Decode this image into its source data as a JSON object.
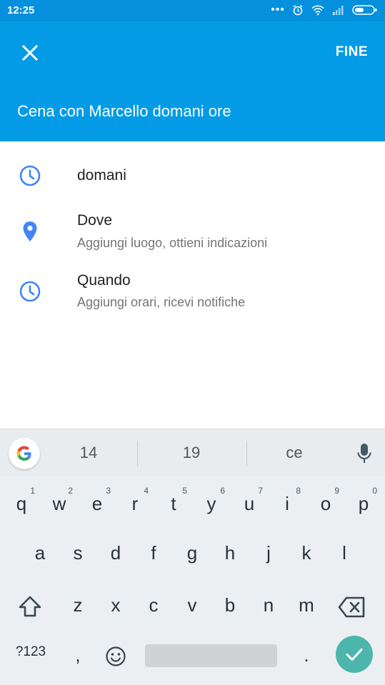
{
  "status_bar": {
    "time": "12:25"
  },
  "header": {
    "done_label": "FINE",
    "title_value": "Cena con Marcello domani ore"
  },
  "rows": [
    {
      "icon": "clock-icon",
      "title": "domani",
      "subtitle": ""
    },
    {
      "icon": "location-pin-icon",
      "title": "Dove",
      "subtitle": "Aggiungi luogo, ottieni indicazioni"
    },
    {
      "icon": "clock-icon",
      "title": "Quando",
      "subtitle": "Aggiungi orari, ricevi notifiche"
    }
  ],
  "keyboard": {
    "suggestions": [
      "14",
      "19",
      "ce"
    ],
    "row1": [
      "q",
      "w",
      "e",
      "r",
      "t",
      "y",
      "u",
      "i",
      "o",
      "p"
    ],
    "row1_hints": [
      "1",
      "2",
      "3",
      "4",
      "5",
      "6",
      "7",
      "8",
      "9",
      "0"
    ],
    "row2": [
      "a",
      "s",
      "d",
      "f",
      "g",
      "h",
      "j",
      "k",
      "l"
    ],
    "row3": [
      "z",
      "x",
      "c",
      "v",
      "b",
      "n",
      "m"
    ],
    "symbols_label": "?123",
    "comma": ",",
    "period": "."
  },
  "colors": {
    "status_bar": "#0490dd",
    "app_bar": "#039be5",
    "icon_blue": "#4285f4",
    "fab": "#4db6ac"
  }
}
